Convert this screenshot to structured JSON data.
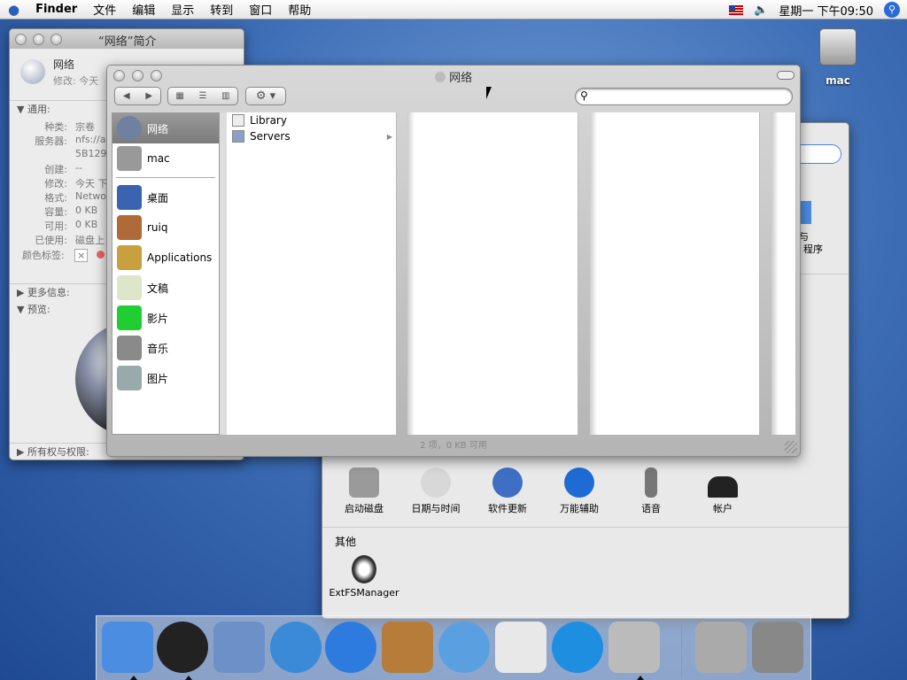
{
  "menubar": {
    "apple": "",
    "app": "Finder",
    "items": [
      "文件",
      "编辑",
      "显示",
      "转到",
      "窗口",
      "帮助"
    ],
    "clock": "星期一 下午09:50",
    "icons": [
      "flag-us-icon",
      "volume-icon",
      "spotlight-icon"
    ]
  },
  "desktop": {
    "icons": [
      {
        "label": "mac",
        "icon": "hard-disk-icon"
      }
    ]
  },
  "info_window": {
    "title": "“网络”简介",
    "name": "网络",
    "modified_short": "修改:  今天",
    "general": "通用:",
    "fields": [
      {
        "label": "种类:",
        "value": "宗卷"
      },
      {
        "label": "服务器:",
        "value": "nfs://a"
      },
      {
        "label": "",
        "value": "5B129"
      },
      {
        "label": "创建:",
        "value": "--"
      },
      {
        "label": "修改:",
        "value": "今天 下"
      },
      {
        "label": "格式:",
        "value": "Networ"
      },
      {
        "label": "容量:",
        "value": "0 KB"
      },
      {
        "label": "可用:",
        "value": "0 KB"
      },
      {
        "label": "已使用:",
        "value": "磁盘上"
      }
    ],
    "color_label": "颜色标签:",
    "more_info": "更多信息:",
    "preview": "预览:",
    "permissions": "所有权与权限:"
  },
  "finder": {
    "title": "网络",
    "search_placeholder": "",
    "sidebar": [
      {
        "label": "网络",
        "icon": "network-icon",
        "selected": true
      },
      {
        "label": "mac",
        "icon": "hard-disk-icon"
      },
      {
        "label": "桌面",
        "icon": "desktop-icon"
      },
      {
        "label": "ruiq",
        "icon": "home-icon"
      },
      {
        "label": "Applications",
        "icon": "applications-icon"
      },
      {
        "label": "文稿",
        "icon": "documents-icon"
      },
      {
        "label": "影片",
        "icon": "movies-icon"
      },
      {
        "label": "音乐",
        "icon": "music-icon"
      },
      {
        "label": "图片",
        "icon": "pictures-icon"
      }
    ],
    "column1": [
      {
        "label": "Library",
        "icon": "alias-icon"
      },
      {
        "label": "Servers",
        "icon": "server-icon",
        "has_children": true
      }
    ],
    "status": "2 项，0 KB 可用"
  },
  "syspref": {
    "partial_text": [
      "与",
      "程序"
    ],
    "prefs": [
      {
        "label": "启动磁盘",
        "color": "#9a9a9a"
      },
      {
        "label": "日期与时间",
        "color": "#d8d8d8"
      },
      {
        "label": "软件更新",
        "color": "#3f6fc4"
      },
      {
        "label": "万能辅助",
        "color": "#1e6bd6"
      },
      {
        "label": "语音",
        "color": "#777"
      },
      {
        "label": "帐户",
        "color": "#222"
      }
    ],
    "other_section": "其他",
    "other": [
      {
        "label": "ExtFSManager",
        "color": "#333"
      }
    ]
  },
  "dock": {
    "items": [
      {
        "name": "finder",
        "color": "#4b8de0"
      },
      {
        "name": "dashboard",
        "color": "#222"
      },
      {
        "name": "mail",
        "color": "#6c91c9"
      },
      {
        "name": "safari",
        "color": "#3b8ad8"
      },
      {
        "name": "ichat",
        "color": "#2e7be0"
      },
      {
        "name": "address-book",
        "color": "#b77b3a"
      },
      {
        "name": "itunes",
        "color": "#5aa0e0"
      },
      {
        "name": "ical",
        "color": "#e8e8e8"
      },
      {
        "name": "quicktime",
        "color": "#1e8fe0"
      },
      {
        "name": "system-preferences",
        "color": "#bbb"
      },
      {
        "name": "internet-connect",
        "color": "#aaa"
      },
      {
        "name": "trash",
        "color": "#888"
      }
    ]
  }
}
